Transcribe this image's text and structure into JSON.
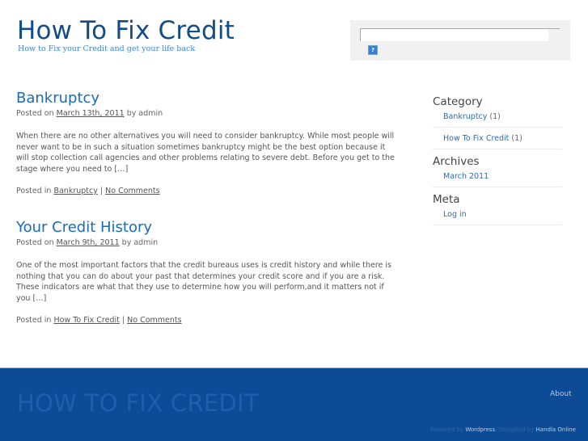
{
  "header": {
    "title": "How To Fix Credit",
    "tagline": "How to Fix your Credit and get your life back"
  },
  "search": {
    "value": "",
    "placeholder": "",
    "button_icon": "search-submit-icon",
    "button_glyph": "?"
  },
  "posts": [
    {
      "title": "Bankruptcy",
      "meta_prefix": "Posted on",
      "date": "March 13th, 2011",
      "meta_by": "by admin",
      "excerpt": "When there are no other alternatives you will need to consider bankruptcy. While most people will never want to be in such a situation sometimes bankruptcy might be the best option because it will stop collection call agencies and other problems relating to severe debt. Before you get to the stage where you need to […]",
      "posted_in_label": "Posted in",
      "category": "Bankruptcy",
      "separator": "|",
      "comments": "No Comments"
    },
    {
      "title": "Your Credit History",
      "meta_prefix": "Posted on",
      "date": "March 9th, 2011",
      "meta_by": "by admin",
      "excerpt": "One of the most important factors that the credit bureaus uses is credit history and while there is nothing that you can do about your past that determines your credit score and if you are a risk. These indicators are what that they use to determine how you will perform,and it matters not if you […]",
      "posted_in_label": "Posted in",
      "category": "How To Fix Credit",
      "separator": "|",
      "comments": "No Comments"
    }
  ],
  "sidebar": {
    "category": {
      "title": "Category",
      "items": [
        {
          "label": "Bankruptcy",
          "count": "(1)"
        },
        {
          "label": "How To Fix Credit",
          "count": "(1)"
        }
      ]
    },
    "archives": {
      "title": "Archives",
      "items": [
        {
          "label": "March 2011"
        }
      ]
    },
    "meta": {
      "title": "Meta",
      "items": [
        {
          "label": "Log in"
        }
      ]
    }
  },
  "footer": {
    "title": "HOW TO FIX CREDIT",
    "nav_about": "About",
    "powered_by": "Powered by",
    "powered_link": "Wordpress",
    "designed_by": ". Designed by",
    "designer_link": "Handla Online"
  },
  "colors": {
    "brand_blue": "#134d88",
    "link_blue": "#1a6bb8",
    "footer_bg": "#0e4b96"
  }
}
